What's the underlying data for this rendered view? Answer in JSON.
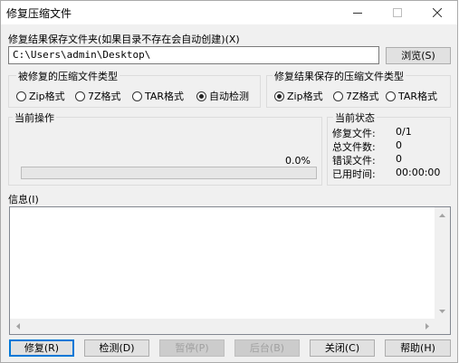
{
  "window": {
    "title": "修复压缩文件"
  },
  "output_folder": {
    "label": "修复结果保存文件夹(如果目录不存在会自动创建)(X)",
    "path": "C:\\Users\\admin\\Desktop\\",
    "browse_label": "浏览(S)"
  },
  "source_type": {
    "title": "被修复的压缩文件类型",
    "options": [
      "Zip格式",
      "7Z格式",
      "TAR格式",
      "自动检测"
    ],
    "selected": "自动检测"
  },
  "result_type": {
    "title": "修复结果保存的压缩文件类型",
    "options": [
      "Zip格式",
      "7Z格式",
      "TAR格式"
    ],
    "selected": "Zip格式"
  },
  "current_operation": {
    "title": "当前操作",
    "percent_text": "0.0%",
    "progress": 0.0
  },
  "current_status": {
    "title": "当前状态",
    "rows": [
      {
        "label": "修复文件:",
        "value": "0/1"
      },
      {
        "label": "总文件数:",
        "value": "0"
      },
      {
        "label": "错误文件:",
        "value": "0"
      },
      {
        "label": "已用时间:",
        "value": "00:00:00"
      }
    ]
  },
  "info": {
    "label": "信息(I)"
  },
  "buttons": {
    "repair": "修复(R)",
    "detect": "检测(D)",
    "pause": "暂停(P)",
    "background": "后台(B)",
    "close": "关闭(C)",
    "help": "帮助(H)"
  },
  "icons": {
    "minimize": "minimize-icon",
    "maximize": "maximize-icon",
    "close": "close-icon"
  }
}
